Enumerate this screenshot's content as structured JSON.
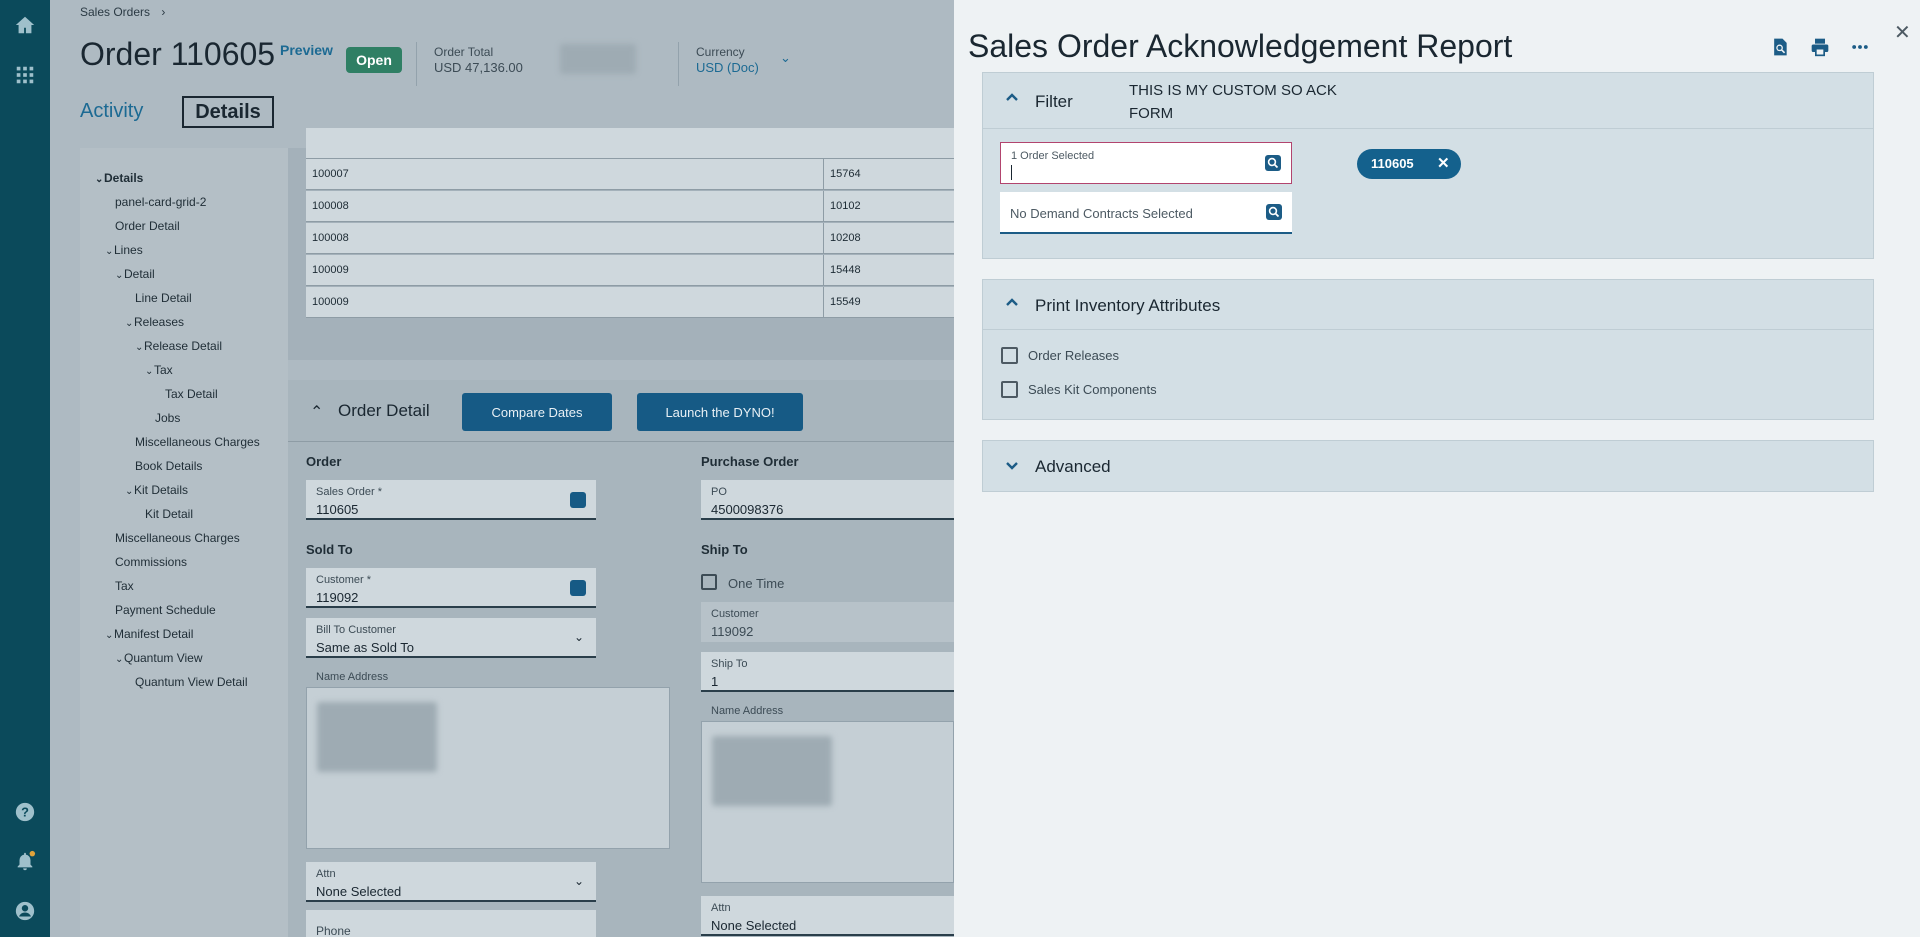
{
  "breadcrumb": {
    "root": "Sales Orders",
    "sep": "›"
  },
  "order": {
    "title": "Order 110605",
    "preview_label": "Preview",
    "status": "Open",
    "total_label": "Order Total",
    "total_value": "USD  47,136.00",
    "currency_label": "Currency",
    "currency_value": "USD (Doc)"
  },
  "tabs": {
    "activity": "Activity",
    "details": "Details"
  },
  "tree": [
    {
      "label": "Details",
      "level": 0,
      "chev": "⌄",
      "bold": true
    },
    {
      "label": "panel-card-grid-2",
      "level": 1
    },
    {
      "label": "Order Detail",
      "level": 1
    },
    {
      "label": "Lines",
      "level": 1,
      "chev": "⌄"
    },
    {
      "label": "Detail",
      "level": 2,
      "chev": "⌄"
    },
    {
      "label": "Line Detail",
      "level": 3
    },
    {
      "label": "Releases",
      "level": 3,
      "chev": "⌄"
    },
    {
      "label": "Release Detail",
      "level": 4,
      "chev": "⌄"
    },
    {
      "label": "Tax",
      "level": 5,
      "chev": "⌄"
    },
    {
      "label": "Tax Detail",
      "level": 6
    },
    {
      "label": "Jobs",
      "level": 5
    },
    {
      "label": "Miscellaneous Charges",
      "level": 3
    },
    {
      "label": "Book Details",
      "level": 3
    },
    {
      "label": "Kit Details",
      "level": 3,
      "chev": "⌄"
    },
    {
      "label": "Kit Detail",
      "level": 4
    },
    {
      "label": "Miscellaneous Charges",
      "level": 1
    },
    {
      "label": "Commissions",
      "level": 1
    },
    {
      "label": "Tax",
      "level": 1
    },
    {
      "label": "Payment Schedule",
      "level": 1
    },
    {
      "label": "Manifest Detail",
      "level": 1,
      "chev": "⌄"
    },
    {
      "label": "Quantum View",
      "level": 2,
      "chev": "⌄"
    },
    {
      "label": "Quantum View Detail",
      "level": 3
    }
  ],
  "grid_rows": [
    {
      "c1": "100007",
      "c2": "15764"
    },
    {
      "c1": "100008",
      "c2": "10102"
    },
    {
      "c1": "100008",
      "c2": "10208"
    },
    {
      "c1": "100009",
      "c2": "15448"
    },
    {
      "c1": "100009",
      "c2": "15549"
    }
  ],
  "order_detail": {
    "title": "Order Detail",
    "compare_btn": "Compare Dates",
    "dyno_btn": "Launch the DYNO!",
    "order_section": "Order",
    "sales_order_label": "Sales Order *",
    "sales_order_value": "110605",
    "po_section": "Purchase Order",
    "po_label": "PO",
    "po_value": "4500098376",
    "sold_to_section": "Sold To",
    "customer_label": "Customer *",
    "customer_value": "119092",
    "bill_to_label": "Bill To Customer",
    "bill_to_value": "Same as Sold To",
    "name_address_label": "Name Address",
    "attn_label": "Attn",
    "attn_value": "None Selected",
    "phone_label": "Phone",
    "ship_to_section": "Ship To",
    "one_time_label": "One Time",
    "ship_customer_label": "Customer",
    "ship_customer_value": "119092",
    "ship_to_label": "Ship To",
    "ship_to_value": "1",
    "ship_name_address_label": "Name Address",
    "ship_attn_label": "Attn",
    "ship_attn_value": "None Selected"
  },
  "drawer": {
    "title": "Sales Order Acknowledgement Report",
    "filter": {
      "title": "Filter",
      "custom_note": "THIS IS MY CUSTOM SO ACK FORM",
      "orders_label": "1 Order Selected",
      "contracts_placeholder": "No Demand Contracts Selected",
      "chip_value": "110605",
      "chip_remove": "✕"
    },
    "inventory": {
      "title": "Print Inventory Attributes",
      "opt1": "Order Releases",
      "opt2": "Sales Kit Components"
    },
    "advanced": {
      "title": "Advanced"
    },
    "close": "✕"
  },
  "colors": {
    "rail": "#0b4a5b",
    "accent": "#1c5c86",
    "status_open": "#2f7f64",
    "chip": "#14618d"
  }
}
